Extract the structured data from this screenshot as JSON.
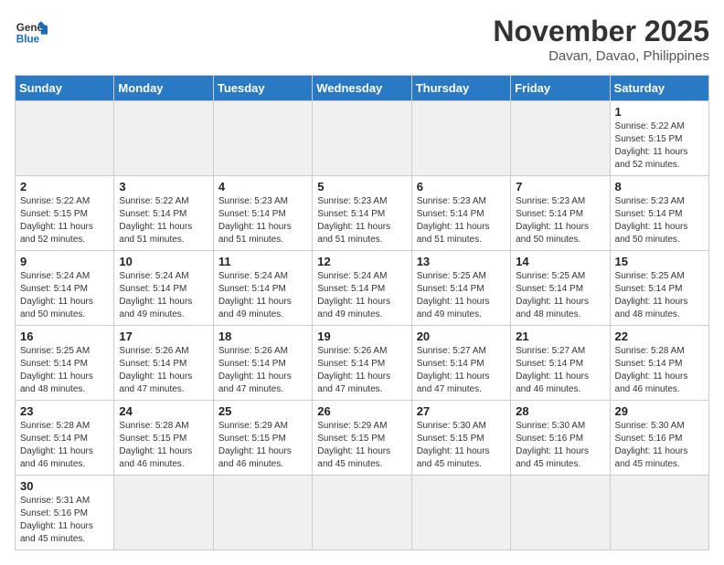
{
  "header": {
    "logo_general": "General",
    "logo_blue": "Blue",
    "month_title": "November 2025",
    "subtitle": "Davan, Davao, Philippines"
  },
  "weekdays": [
    "Sunday",
    "Monday",
    "Tuesday",
    "Wednesday",
    "Thursday",
    "Friday",
    "Saturday"
  ],
  "weeks": [
    [
      {
        "day": "",
        "info": ""
      },
      {
        "day": "",
        "info": ""
      },
      {
        "day": "",
        "info": ""
      },
      {
        "day": "",
        "info": ""
      },
      {
        "day": "",
        "info": ""
      },
      {
        "day": "",
        "info": ""
      },
      {
        "day": "1",
        "info": "Sunrise: 5:22 AM\nSunset: 5:15 PM\nDaylight: 11 hours\nand 52 minutes."
      }
    ],
    [
      {
        "day": "2",
        "info": "Sunrise: 5:22 AM\nSunset: 5:15 PM\nDaylight: 11 hours\nand 52 minutes."
      },
      {
        "day": "3",
        "info": "Sunrise: 5:22 AM\nSunset: 5:14 PM\nDaylight: 11 hours\nand 51 minutes."
      },
      {
        "day": "4",
        "info": "Sunrise: 5:23 AM\nSunset: 5:14 PM\nDaylight: 11 hours\nand 51 minutes."
      },
      {
        "day": "5",
        "info": "Sunrise: 5:23 AM\nSunset: 5:14 PM\nDaylight: 11 hours\nand 51 minutes."
      },
      {
        "day": "6",
        "info": "Sunrise: 5:23 AM\nSunset: 5:14 PM\nDaylight: 11 hours\nand 51 minutes."
      },
      {
        "day": "7",
        "info": "Sunrise: 5:23 AM\nSunset: 5:14 PM\nDaylight: 11 hours\nand 50 minutes."
      },
      {
        "day": "8",
        "info": "Sunrise: 5:23 AM\nSunset: 5:14 PM\nDaylight: 11 hours\nand 50 minutes."
      }
    ],
    [
      {
        "day": "9",
        "info": "Sunrise: 5:24 AM\nSunset: 5:14 PM\nDaylight: 11 hours\nand 50 minutes."
      },
      {
        "day": "10",
        "info": "Sunrise: 5:24 AM\nSunset: 5:14 PM\nDaylight: 11 hours\nand 49 minutes."
      },
      {
        "day": "11",
        "info": "Sunrise: 5:24 AM\nSunset: 5:14 PM\nDaylight: 11 hours\nand 49 minutes."
      },
      {
        "day": "12",
        "info": "Sunrise: 5:24 AM\nSunset: 5:14 PM\nDaylight: 11 hours\nand 49 minutes."
      },
      {
        "day": "13",
        "info": "Sunrise: 5:25 AM\nSunset: 5:14 PM\nDaylight: 11 hours\nand 49 minutes."
      },
      {
        "day": "14",
        "info": "Sunrise: 5:25 AM\nSunset: 5:14 PM\nDaylight: 11 hours\nand 48 minutes."
      },
      {
        "day": "15",
        "info": "Sunrise: 5:25 AM\nSunset: 5:14 PM\nDaylight: 11 hours\nand 48 minutes."
      }
    ],
    [
      {
        "day": "16",
        "info": "Sunrise: 5:25 AM\nSunset: 5:14 PM\nDaylight: 11 hours\nand 48 minutes."
      },
      {
        "day": "17",
        "info": "Sunrise: 5:26 AM\nSunset: 5:14 PM\nDaylight: 11 hours\nand 47 minutes."
      },
      {
        "day": "18",
        "info": "Sunrise: 5:26 AM\nSunset: 5:14 PM\nDaylight: 11 hours\nand 47 minutes."
      },
      {
        "day": "19",
        "info": "Sunrise: 5:26 AM\nSunset: 5:14 PM\nDaylight: 11 hours\nand 47 minutes."
      },
      {
        "day": "20",
        "info": "Sunrise: 5:27 AM\nSunset: 5:14 PM\nDaylight: 11 hours\nand 47 minutes."
      },
      {
        "day": "21",
        "info": "Sunrise: 5:27 AM\nSunset: 5:14 PM\nDaylight: 11 hours\nand 46 minutes."
      },
      {
        "day": "22",
        "info": "Sunrise: 5:28 AM\nSunset: 5:14 PM\nDaylight: 11 hours\nand 46 minutes."
      }
    ],
    [
      {
        "day": "23",
        "info": "Sunrise: 5:28 AM\nSunset: 5:14 PM\nDaylight: 11 hours\nand 46 minutes."
      },
      {
        "day": "24",
        "info": "Sunrise: 5:28 AM\nSunset: 5:15 PM\nDaylight: 11 hours\nand 46 minutes."
      },
      {
        "day": "25",
        "info": "Sunrise: 5:29 AM\nSunset: 5:15 PM\nDaylight: 11 hours\nand 46 minutes."
      },
      {
        "day": "26",
        "info": "Sunrise: 5:29 AM\nSunset: 5:15 PM\nDaylight: 11 hours\nand 45 minutes."
      },
      {
        "day": "27",
        "info": "Sunrise: 5:30 AM\nSunset: 5:15 PM\nDaylight: 11 hours\nand 45 minutes."
      },
      {
        "day": "28",
        "info": "Sunrise: 5:30 AM\nSunset: 5:16 PM\nDaylight: 11 hours\nand 45 minutes."
      },
      {
        "day": "29",
        "info": "Sunrise: 5:30 AM\nSunset: 5:16 PM\nDaylight: 11 hours\nand 45 minutes."
      }
    ],
    [
      {
        "day": "30",
        "info": "Sunrise: 5:31 AM\nSunset: 5:16 PM\nDaylight: 11 hours\nand 45 minutes."
      },
      {
        "day": "",
        "info": ""
      },
      {
        "day": "",
        "info": ""
      },
      {
        "day": "",
        "info": ""
      },
      {
        "day": "",
        "info": ""
      },
      {
        "day": "",
        "info": ""
      },
      {
        "day": "",
        "info": ""
      }
    ]
  ]
}
